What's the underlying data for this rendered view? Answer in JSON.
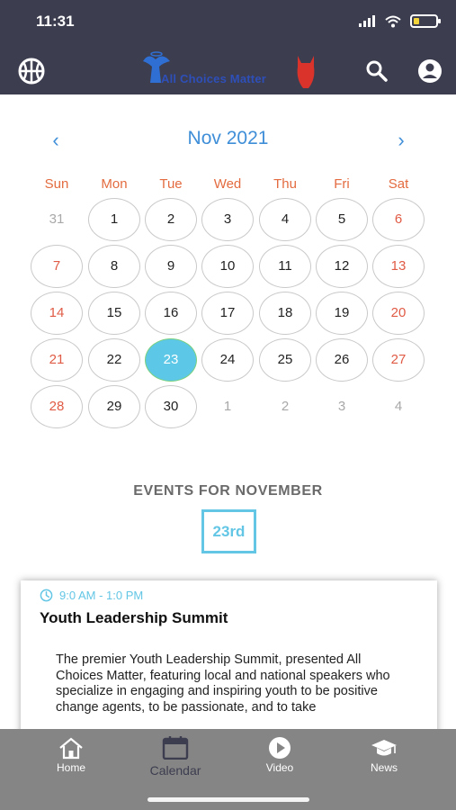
{
  "status_bar": {
    "time": "11:31"
  },
  "app_bar": {
    "logo_text": "All Choices Matter",
    "left_icon": "basketball-icon",
    "search_icon": "search-icon",
    "account_icon": "account-icon"
  },
  "calendar": {
    "month_title": "Nov 2021",
    "prev_label": "‹",
    "next_label": "›",
    "weekdays": [
      "Sun",
      "Mon",
      "Tue",
      "Wed",
      "Thu",
      "Fri",
      "Sat"
    ],
    "days": [
      "31",
      "1",
      "2",
      "3",
      "4",
      "5",
      "6",
      "7",
      "8",
      "9",
      "10",
      "11",
      "12",
      "13",
      "14",
      "15",
      "16",
      "17",
      "18",
      "19",
      "20",
      "21",
      "22",
      "23",
      "24",
      "25",
      "26",
      "27",
      "28",
      "29",
      "30",
      "1",
      "2",
      "3",
      "4"
    ],
    "selected_day": "23"
  },
  "events": {
    "heading": "EVENTS FOR NOVEMBER",
    "selected_date": "23rd",
    "items": [
      {
        "time": "9:0 AM - 1:0 PM",
        "title": "Youth Leadership Summit",
        "description": "The premier Youth Leadership Summit, presented All Choices Matter, featuring  local and national speakers who specialize in engaging and inspiring youth to be positive change agents, to be passionate, and to take"
      }
    ]
  },
  "tabbar": {
    "tabs": [
      {
        "label": "Home",
        "icon": "home-icon"
      },
      {
        "label": "Calendar",
        "icon": "calendar-icon"
      },
      {
        "label": "Video",
        "icon": "play-icon"
      },
      {
        "label": "News",
        "icon": "graduation-cap-icon"
      }
    ],
    "active": "Calendar"
  },
  "colors": {
    "header_bg": "#3c3d4f",
    "accent_blue": "#3f8ed8",
    "weekday_orange": "#e36b3f",
    "weekend_red": "#e05b45",
    "selected_fill": "#5cc7e6",
    "tabbar_bg": "#858585"
  }
}
